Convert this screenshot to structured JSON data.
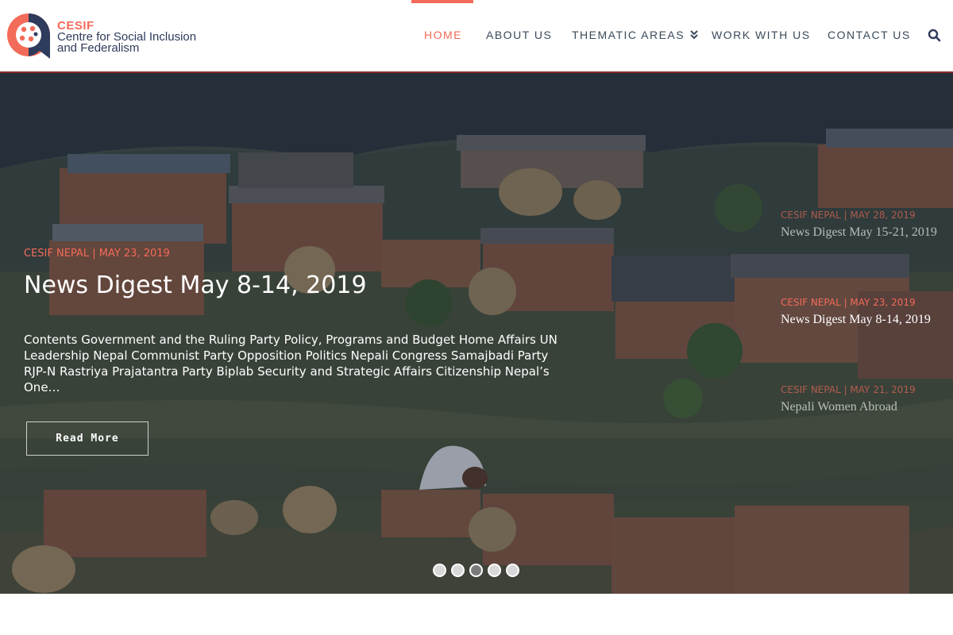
{
  "site": {
    "logo_title": "CESIF",
    "logo_subtitle": "Centre for Social Inclusion and Federalism"
  },
  "nav": {
    "items": [
      {
        "label": "HOME",
        "active": true
      },
      {
        "label": "ABOUT US"
      },
      {
        "label": "THEMATIC AREAS"
      },
      {
        "label": "WORK WITH US"
      },
      {
        "label": "CONTACT US"
      }
    ],
    "dropdown_icon": "double-chevron-down-icon",
    "search_icon": "search-icon"
  },
  "hero": {
    "current": {
      "meta": "CESIF NEPAL | MAY 23, 2019",
      "title": "News Digest May 8-14, 2019",
      "excerpt": "Contents Government and the Ruling Party Policy, Programs and Budget Home Affairs UN Leadership Nepal Communist Party Opposition Politics Nepali Congress Samajbadi Party RJP-N Rastriya Prajatantra Party Biplab Security and Strategic Affairs Citizenship Nepal’s One…",
      "read_more": "Read More"
    },
    "side_posts": [
      {
        "meta": "CESIF NEPAL | MAY 28, 2019",
        "title": "News Digest May 15-21, 2019"
      },
      {
        "meta": "CESIF NEPAL | MAY 23, 2019",
        "title": "News Digest May 8-14, 2019"
      },
      {
        "meta": "CESIF NEPAL | MAY 21, 2019",
        "title": "Nepali Women Abroad"
      }
    ],
    "dots_count": 5,
    "active_dot": 2
  },
  "colors": {
    "accent": "#f36b59",
    "navy": "#2f3b5c",
    "header_border": "#8e2a2a"
  }
}
